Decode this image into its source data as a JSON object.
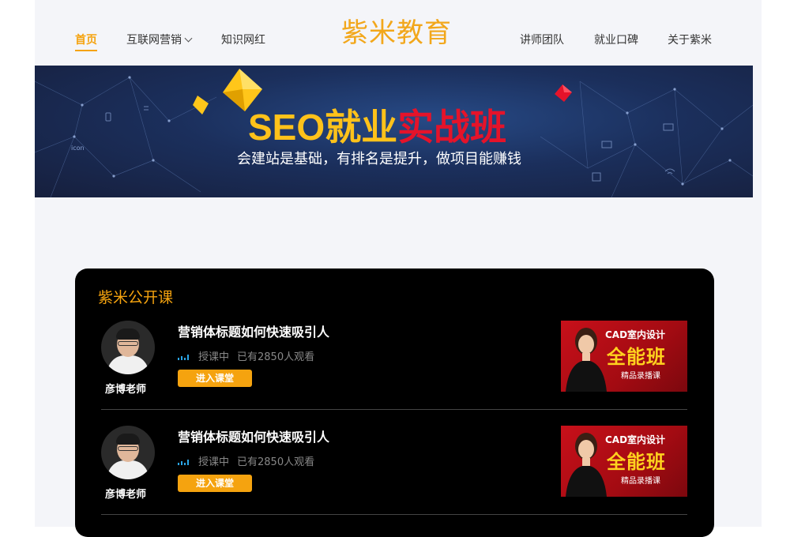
{
  "nav": {
    "home": "首页",
    "internet_marketing": "互联网营销",
    "knowledge": "知识网红",
    "logo": "紫米教育",
    "teachers": "讲师团队",
    "reputation": "就业口碑",
    "about": "关于紫米"
  },
  "banner": {
    "title_yellow": "SEO就业",
    "title_red": "实战班",
    "subtitle": "会建站是基础，有排名是提升，做项目能赚钱",
    "icon_text": "icon"
  },
  "panel": {
    "title": "紫米公开课",
    "courses": [
      {
        "title": "营销体标题如何快速吸引人",
        "status": "授课中",
        "views": "已有2850人观看",
        "button": "进入课堂",
        "teacher": "彦博老师",
        "thumb_line1": "CAD室内设计",
        "thumb_line2": "全能班",
        "thumb_line3": "精品录播课"
      },
      {
        "title": "营销体标题如何快速吸引人",
        "status": "授课中",
        "views": "已有2850人观看",
        "button": "进入课堂",
        "teacher": "彦博老师",
        "thumb_line1": "CAD室内设计",
        "thumb_line2": "全能班",
        "thumb_line3": "精品录播课"
      }
    ]
  },
  "colors": {
    "accent": "#f5a30f",
    "live_indicator": "#2aa6e8",
    "thumb_red": "#c8101a"
  }
}
